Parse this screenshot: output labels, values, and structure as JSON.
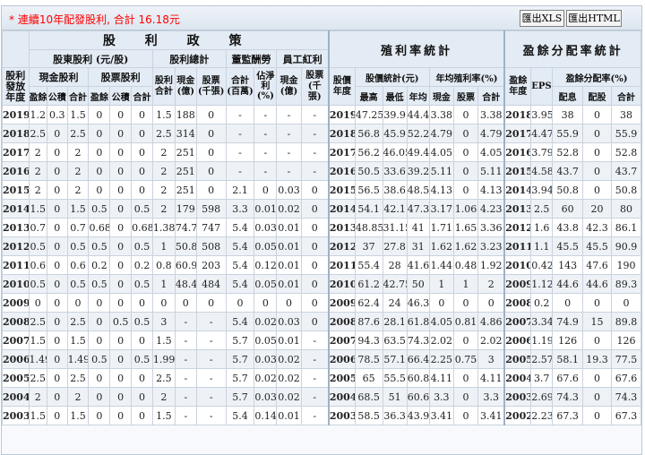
{
  "notice": "* 連續10年配發股利, 合計 16.18元",
  "buttons": {
    "xls": "匯出XLS",
    "html": "匯出HTML"
  },
  "headers": {
    "policy": "股 利 政 策",
    "yield": "殖利率統計",
    "payout": "盈餘分配率統計",
    "year": "股利發放年度",
    "shareholder_div": "股東股利 (元/股)",
    "div_total": "股利總計",
    "board": "董監酬勞",
    "employee": "員工紅利",
    "cash_div": "現金股利",
    "stock_div": "股票股利",
    "div_sum": "股利合計",
    "cash_e": "現金(億)",
    "stock_k": "股票(千張)",
    "board_sum": "合計(百萬)",
    "board_ratio": "佔淨利(%)",
    "emp_cash": "現金(億)",
    "emp_stock": "股票(千張)",
    "price_year": "股價年度",
    "price_stats": "股價統計(元)",
    "avg_yield": "年均殖利率(%)",
    "earn_year": "盈餘年度",
    "eps": "EPS(元)",
    "payout_rate": "盈餘分配率(%)",
    "surplus": "盈餘",
    "reserve": "公積",
    "total": "合計",
    "high": "最高",
    "low": "最低",
    "avg": "年均",
    "cash": "現金",
    "stock": "股票",
    "alloc": "配息",
    "share": "配股"
  },
  "rows": [
    [
      "2019",
      "1.2",
      "0.3",
      "1.5",
      "0",
      "0",
      "0",
      "1.5",
      "188",
      "0",
      "-",
      "-",
      "-",
      "-",
      "2019",
      "47.25",
      "39.9",
      "44.4",
      "3.38",
      "0",
      "3.38",
      "2018",
      "3.95",
      "38",
      "0",
      "38"
    ],
    [
      "2018",
      "2.5",
      "0",
      "2.5",
      "0",
      "0",
      "0",
      "2.5",
      "314",
      "0",
      "-",
      "-",
      "-",
      "-",
      "2018",
      "56.8",
      "45.9",
      "52.2",
      "4.79",
      "0",
      "4.79",
      "2017",
      "4.47",
      "55.9",
      "0",
      "55.9"
    ],
    [
      "2017",
      "2",
      "0",
      "2",
      "0",
      "0",
      "0",
      "2",
      "251",
      "0",
      "-",
      "-",
      "-",
      "-",
      "2017",
      "56.2",
      "46.05",
      "49.4",
      "4.05",
      "0",
      "4.05",
      "2016",
      "3.79",
      "52.8",
      "0",
      "52.8"
    ],
    [
      "2016",
      "2",
      "0",
      "2",
      "0",
      "0",
      "0",
      "2",
      "251",
      "0",
      "-",
      "-",
      "-",
      "-",
      "2016",
      "50.5",
      "33.6",
      "39.2",
      "5.11",
      "0",
      "5.11",
      "2015",
      "4.58",
      "43.7",
      "0",
      "43.7"
    ],
    [
      "2015",
      "2",
      "0",
      "2",
      "0",
      "0",
      "0",
      "2",
      "251",
      "0",
      "2.1",
      "0",
      "0.03",
      "0",
      "2015",
      "56.5",
      "38.6",
      "48.5",
      "4.13",
      "0",
      "4.13",
      "2014",
      "3.94",
      "50.8",
      "0",
      "50.8"
    ],
    [
      "2014",
      "1.5",
      "0",
      "1.5",
      "0.5",
      "0",
      "0.5",
      "2",
      "179",
      "598",
      "3.3",
      "0.01",
      "0.02",
      "0",
      "2014",
      "54.1",
      "42.1",
      "47.3",
      "3.17",
      "1.06",
      "4.23",
      "2013",
      "2.5",
      "60",
      "20",
      "80"
    ],
    [
      "2013",
      "0.7",
      "0",
      "0.7",
      "0.68",
      "0",
      "0.68",
      "1.38",
      "74.7",
      "747",
      "5.4",
      "0.03",
      "0.01",
      "0",
      "2013",
      "48.85",
      "31.15",
      "41",
      "1.71",
      "1.65",
      "3.36",
      "2012",
      "1.6",
      "43.8",
      "42.3",
      "86.1"
    ],
    [
      "2012",
      "0.5",
      "0",
      "0.5",
      "0.5",
      "0",
      "0.5",
      "1",
      "50.8",
      "508",
      "5.4",
      "0.05",
      "0.01",
      "0",
      "2012",
      "37",
      "27.8",
      "31",
      "1.62",
      "1.62",
      "3.23",
      "2011",
      "1.1",
      "45.5",
      "45.5",
      "90.9"
    ],
    [
      "2011",
      "0.6",
      "0",
      "0.6",
      "0.2",
      "0",
      "0.2",
      "0.8",
      "60.9",
      "203",
      "5.4",
      "0.12",
      "0.01",
      "0",
      "2011",
      "55.4",
      "28",
      "41.6",
      "1.44",
      "0.48",
      "1.92",
      "2010",
      "0.42",
      "143",
      "47.6",
      "190"
    ],
    [
      "2010",
      "0.5",
      "0",
      "0.5",
      "0.5",
      "0",
      "0.5",
      "1",
      "48.4",
      "484",
      "5.4",
      "0.05",
      "0.01",
      "0",
      "2010",
      "61.2",
      "42.75",
      "50",
      "1",
      "1",
      "2",
      "2009",
      "1.12",
      "44.6",
      "44.6",
      "89.3"
    ],
    [
      "2009",
      "0",
      "0",
      "0",
      "0",
      "0",
      "0",
      "0",
      "0",
      "0",
      "0",
      "0",
      "0",
      "0",
      "2009",
      "62.4",
      "24",
      "46.3",
      "0",
      "0",
      "0",
      "2008",
      "0.2",
      "0",
      "0",
      "0"
    ],
    [
      "2008",
      "2.5",
      "0",
      "2.5",
      "0",
      "0.5",
      "0.5",
      "3",
      "-",
      "-",
      "5.4",
      "0.02",
      "0.03",
      "0",
      "2008",
      "87.6",
      "28.1",
      "61.8",
      "4.05",
      "0.81",
      "4.86",
      "2007",
      "3.34",
      "74.9",
      "15",
      "89.8"
    ],
    [
      "2007",
      "1.5",
      "0",
      "1.5",
      "0",
      "0",
      "0",
      "1.5",
      "-",
      "-",
      "5.7",
      "0.05",
      "0.01",
      "-",
      "2007",
      "94.3",
      "63.5",
      "74.3",
      "2.02",
      "0",
      "2.02",
      "2006",
      "1.19",
      "126",
      "0",
      "126"
    ],
    [
      "2006",
      "1.49",
      "0",
      "1.49",
      "0.5",
      "0",
      "0.5",
      "1.99",
      "-",
      "-",
      "5.7",
      "0.03",
      "0.02",
      "-",
      "2006",
      "78.5",
      "57.1",
      "66.4",
      "2.25",
      "0.75",
      "3",
      "2005",
      "2.57",
      "58.1",
      "19.3",
      "77.5"
    ],
    [
      "2005",
      "2.5",
      "0",
      "2.5",
      "0",
      "0",
      "0",
      "2.5",
      "-",
      "-",
      "5.7",
      "0.02",
      "0.02",
      "-",
      "2005",
      "65",
      "55.5",
      "60.8",
      "4.11",
      "0",
      "4.11",
      "2004",
      "3.7",
      "67.6",
      "0",
      "67.6"
    ],
    [
      "2004",
      "2",
      "0",
      "2",
      "0",
      "0",
      "0",
      "2",
      "-",
      "-",
      "5.7",
      "0.03",
      "0.02",
      "-",
      "2004",
      "68.5",
      "51",
      "60.6",
      "3.3",
      "0",
      "3.3",
      "2003",
      "2.69",
      "74.3",
      "0",
      "74.3"
    ],
    [
      "2003",
      "1.5",
      "0",
      "1.5",
      "0",
      "0",
      "0",
      "1.5",
      "-",
      "-",
      "5.4",
      "0.14",
      "0.01",
      "-",
      "2003",
      "58.5",
      "36.3",
      "43.9",
      "3.41",
      "0",
      "3.41",
      "2002",
      "2.23",
      "67.3",
      "0",
      "67.3"
    ]
  ]
}
